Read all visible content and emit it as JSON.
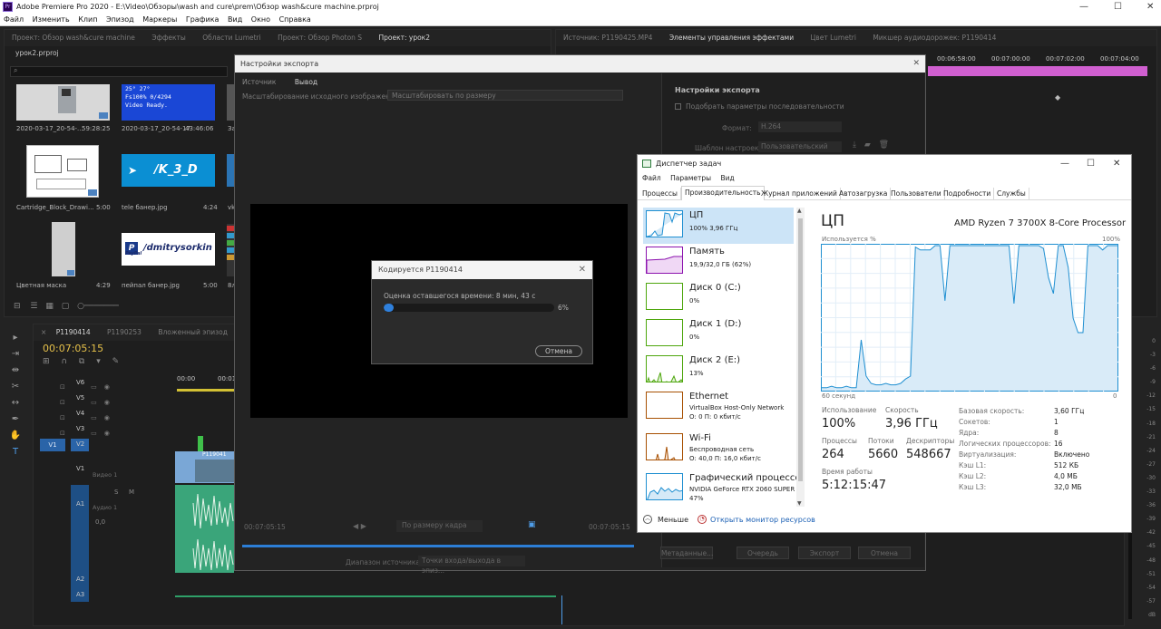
{
  "window": {
    "title": "Adobe Premiere Pro 2020 - E:\\Video\\Обзоры\\wash and cure\\prem\\Обзор wash&cure machine.prproj",
    "logo": "Pr"
  },
  "menu": [
    "Файл",
    "Изменить",
    "Клип",
    "Эпизод",
    "Маркеры",
    "Графика",
    "Вид",
    "Окно",
    "Справка"
  ],
  "panels": {
    "left_tabs": [
      "Проект: Обзор wash&cure machine",
      "Эффекты",
      "Области Lumetri",
      "Проект: Обзор Photon S",
      "Проект: урок2"
    ],
    "right_tabs": [
      "Источник: P1190425.MP4",
      "Элементы управления эффектами",
      "Цвет Lumetri",
      "Микшер аудиодорожек: P1190414"
    ],
    "right_timecodes": [
      "00:06:58:00",
      "00:07:00:00",
      "00:07:02:00",
      "00:07:04:00"
    ],
    "project_name": "урок2.prproj",
    "bin_items": [
      {
        "name": "2020-03-17_20-54-...",
        "duration": "59:28:25"
      },
      {
        "name": "2020-03-17_20-54-17",
        "duration": "43:46:06"
      },
      {
        "name": "Cartridge_Block_Drawi...",
        "duration": "5:00"
      },
      {
        "name": "tele банер.jpg",
        "duration": "4:24"
      },
      {
        "name": "Цветная маска",
        "duration": "4:29"
      },
      {
        "name": "пейпал банер.jpg",
        "duration": "5:00"
      }
    ],
    "bin_partial_labels": [
      "За",
      "vk",
      "8л"
    ],
    "thumb_texts": {
      "lcd_line1": "25°   27°",
      "lcd_line2": "Fs100%    0/4294",
      "lcd_line3": "Video Ready.",
      "tele": "/K_3_D",
      "paypal": "/dmitrysorkin",
      "paypal_brand": "PayPal"
    }
  },
  "timeline": {
    "tabs": [
      "P1190414",
      "P1190253",
      "Вложенный эпизод"
    ],
    "timecode": "00:07:05:15",
    "ruler": [
      "00:00",
      "00:01"
    ],
    "tracks": [
      "V6",
      "V5",
      "V4",
      "V3",
      "V2",
      "V1",
      "A1",
      "A2",
      "A3"
    ],
    "source_v": "V1",
    "clip_name": "P119041",
    "track_names": {
      "video": "Видео 1",
      "audio": "Аудио 1"
    },
    "audio_params": {
      "solo": "S",
      "mute": "M",
      "level": "0,0"
    },
    "meter": [
      "0",
      "-3",
      "-6",
      "-9",
      "-12",
      "-15",
      "-18",
      "-21",
      "-24",
      "-27",
      "-30",
      "-33",
      "-36",
      "-39",
      "-42",
      "-45",
      "-48",
      "-51",
      "-54",
      "-57",
      "dB"
    ]
  },
  "export": {
    "title": "Настройки экспорта",
    "tabs": [
      "Источник",
      "Вывод"
    ],
    "scaling_label": "Масштабирование исходного изображения:",
    "scaling_value": "Масштабировать по размеру",
    "settings_header": "Настройки экспорта",
    "match_seq": "Подобрать параметры последовательности",
    "format_label": "Формат:",
    "format_value": "H.264",
    "preset_label": "Шаблон настроек:",
    "preset_value": "Пользовательский",
    "tc_in": "00:07:05:15",
    "tc_out": "00:07:05:15",
    "fit": "По размеру кадра",
    "range_label": "Диапазон источника:",
    "range_value": "Точки входа/выхода в эпиз...",
    "meta_button": "Метаданные...",
    "queue_button": "Очередь",
    "export_button": "Экспорт",
    "cancel_button": "Отмена"
  },
  "encoding": {
    "title": "Кодируется P1190414",
    "estimate": "Оценка оставшегося времени: 8 мин, 43 с",
    "progress": 6,
    "progress_label": "6%",
    "cancel": "Отмена"
  },
  "taskmgr": {
    "title": "Диспетчер задач",
    "menu": [
      "Файл",
      "Параметры",
      "Вид"
    ],
    "tabs": [
      "Процессы",
      "Производительность",
      "Журнал приложений",
      "Автозагрузка",
      "Пользователи",
      "Подробности",
      "Службы"
    ],
    "side": [
      {
        "name": "ЦП",
        "sub": "100%  3,96 ГГц",
        "color": "#1f8fd1"
      },
      {
        "name": "Память",
        "sub": "19,9/32,0 ГБ (62%)",
        "color": "#8b12ae"
      },
      {
        "name": "Диск 0 (C:)",
        "sub": "0%",
        "color": "#4da60c"
      },
      {
        "name": "Диск 1 (D:)",
        "sub": "0%",
        "color": "#4da60c"
      },
      {
        "name": "Диск 2 (E:)",
        "sub": "13%",
        "color": "#4da60c"
      },
      {
        "name": "Ethernet",
        "sub": "VirtualBox Host-Only Network",
        "sub2": "О: 0 П: 0 кбит/с",
        "color": "#a74f01"
      },
      {
        "name": "Wi-Fi",
        "sub": "Беспроводная сеть",
        "sub2": "О: 40,0 П: 16,0 кбит/с",
        "color": "#a74f01"
      },
      {
        "name": "Графический процессор",
        "sub": "NVIDIA GeForce RTX 2060 SUPER",
        "sub2": "47%",
        "color": "#1f8fd1"
      }
    ],
    "main_title": "ЦП",
    "cpu_name": "AMD Ryzen 7 3700X 8-Core Processor",
    "graph_top_left": "Используется %",
    "graph_top_right": "100%",
    "graph_bottom_left": "60 секунд",
    "graph_bottom_right": "0",
    "stats": {
      "usage_label": "Использование",
      "usage": "100%",
      "speed_label": "Скорость",
      "speed": "3,96 ГГц",
      "proc_label": "Процессы",
      "proc": "264",
      "threads_label": "Потоки",
      "threads": "5660",
      "handles_label": "Дескрипторы",
      "handles": "548667",
      "uptime_label": "Время работы",
      "uptime": "5:12:15:47"
    },
    "specs": [
      {
        "k": "Базовая скорость:",
        "v": "3,60 ГГц"
      },
      {
        "k": "Сокетов:",
        "v": "1"
      },
      {
        "k": "Ядра:",
        "v": "8"
      },
      {
        "k": "Логических процессоров:",
        "v": "16"
      },
      {
        "k": "Виртуализация:",
        "v": "Включено"
      },
      {
        "k": "Кэш L1:",
        "v": "512 КБ"
      },
      {
        "k": "Кэш L2:",
        "v": "4,0 МБ"
      },
      {
        "k": "Кэш L3:",
        "v": "32,0 МБ"
      }
    ],
    "less": "Меньше",
    "resmon": "Открыть монитор ресурсов",
    "cpu_history": [
      2,
      2,
      3,
      2,
      2,
      3,
      2,
      2,
      35,
      10,
      5,
      4,
      4,
      5,
      4,
      4,
      5,
      8,
      10,
      99,
      97,
      97,
      97,
      100,
      100,
      62,
      100,
      100,
      100,
      100,
      100,
      100,
      100,
      100,
      100,
      100,
      100,
      100,
      100,
      60,
      100,
      100,
      100,
      100,
      100,
      98,
      78,
      67,
      100,
      100,
      85,
      50,
      40,
      40,
      100,
      100,
      100,
      97,
      100,
      100,
      100
    ]
  }
}
